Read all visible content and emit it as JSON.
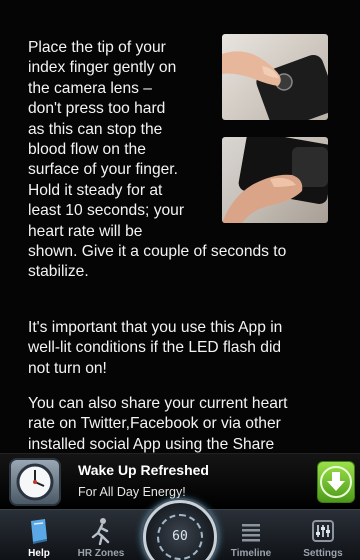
{
  "instructions": {
    "para1_lines": [
      "Place the tip of your",
      "index finger gently on",
      "the camera lens –",
      "don't press too hard",
      "as this can stop the",
      "blood flow on the",
      "surface of your finger.",
      "Hold it steady for at",
      "least 10 seconds; your",
      "heart rate will be",
      "shown. Give it a couple of seconds to",
      "stabilize."
    ],
    "para2_lines": [
      "It's important that you use this App in",
      "well-lit conditions if the LED flash did",
      "not turn on!"
    ],
    "para3_lines": [
      "You can also share your current heart",
      "rate on Twitter,Facebook or via other",
      "installed social App using the Share"
    ]
  },
  "ad": {
    "title": "Wake Up Refreshed",
    "subtitle": "For All Day Energy!",
    "icon": "alarm-clock-icon",
    "action_icon": "download-arrow-icon"
  },
  "tabs": [
    {
      "label": "Help",
      "icon": "book-icon",
      "active": true
    },
    {
      "label": "HR Zones",
      "icon": "runner-icon",
      "active": false
    },
    {
      "label": "Timeline",
      "icon": "list-icon",
      "active": false
    },
    {
      "label": "Settings",
      "icon": "sliders-icon",
      "active": false
    }
  ],
  "measure": {
    "value": "60",
    "icon": "heart-measure-icon"
  },
  "colors": {
    "background": "#050505",
    "text": "#f4f4f4",
    "ad_button": "#6bbf2a",
    "tabbar": "#1a1f25",
    "active_tab_icon": "#5aa9e6"
  }
}
